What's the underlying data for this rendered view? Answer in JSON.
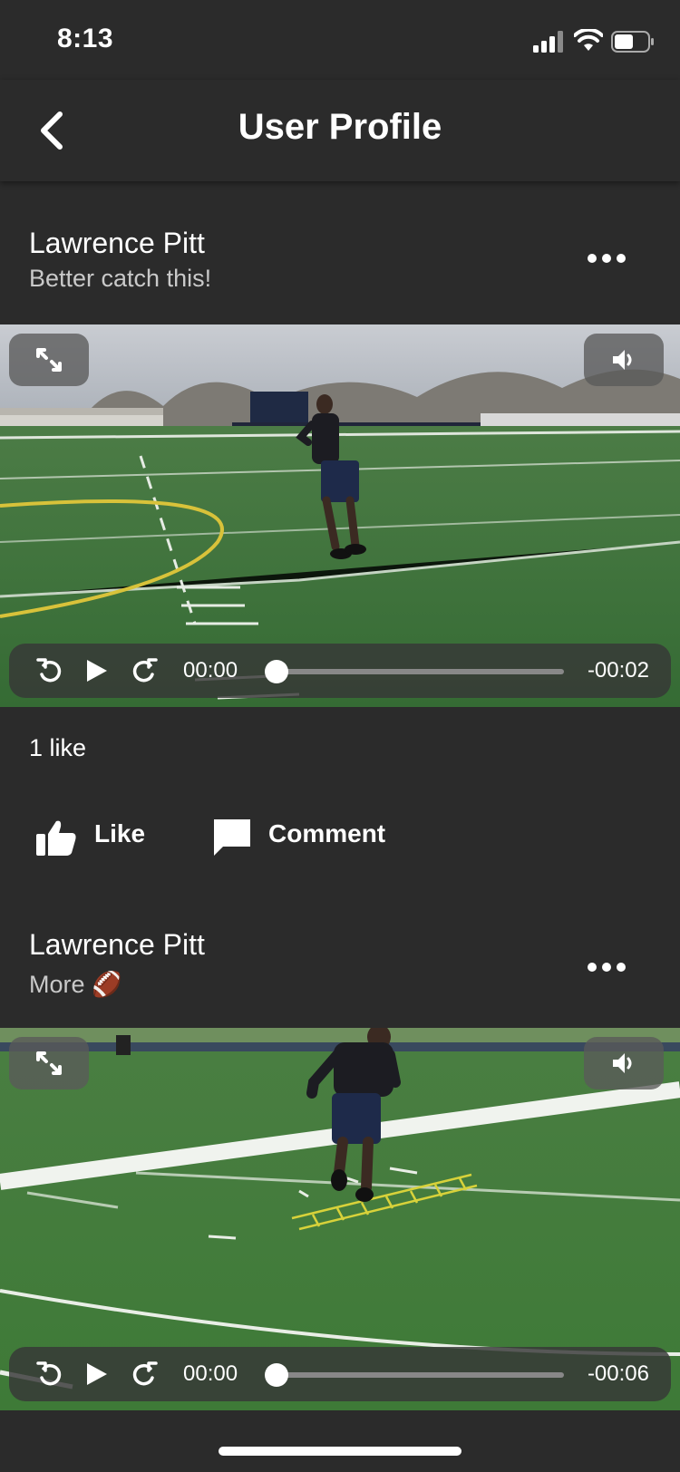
{
  "status_bar": {
    "time": "8:13"
  },
  "nav": {
    "title": "User Profile"
  },
  "posts": [
    {
      "author": "Lawrence Pitt",
      "caption": "Better catch this!",
      "video": {
        "current_time": "00:00",
        "remaining_time": "-00:02",
        "progress": 0
      },
      "likes_text": "1 like",
      "actions": {
        "like_label": "Like",
        "comment_label": "Comment"
      }
    },
    {
      "author": "Lawrence Pitt",
      "caption": "More 🏈",
      "video": {
        "current_time": "00:00",
        "remaining_time": "-00:06",
        "progress": 0
      }
    }
  ],
  "colors": {
    "background": "#2b2b2b",
    "text": "#ffffff",
    "caption": "#c9c9c9",
    "turf": "#3f7e3c"
  }
}
